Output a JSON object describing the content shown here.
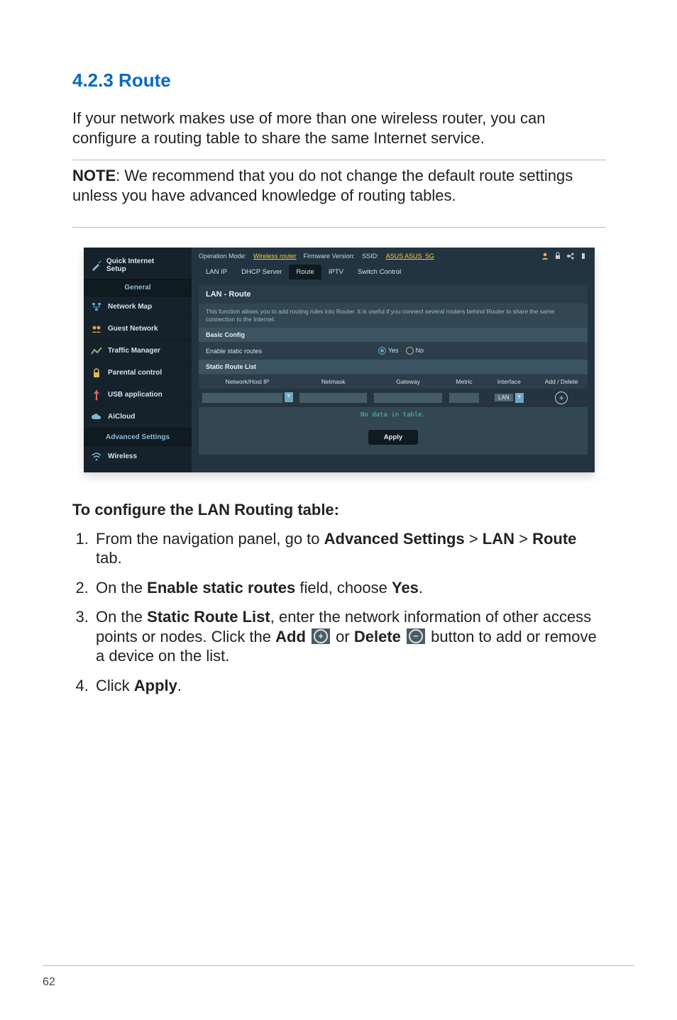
{
  "section_heading": "4.2.3 Route",
  "intro": "If your network makes use of more than one wireless router, you can configure a routing table to share the same Internet service.",
  "note_label": "NOTE",
  "note_body": ":  We recommend that you do not change the default route settings unless you have advanced knowledge of routing tables.",
  "screenshot": {
    "top": {
      "op_mode_label": "Operation Mode:",
      "op_mode_value": "Wireless router",
      "fw_label": "Firmware Version:",
      "ssid_label": "SSID:",
      "ssid_value": "ASUS  ASUS_5G"
    },
    "qis": {
      "line1": "Quick Internet",
      "line2": "Setup"
    },
    "sidebar": {
      "general_label": "General",
      "items_general": [
        "Network Map",
        "Guest Network",
        "Traffic Manager",
        "Parental control",
        "USB application",
        "AiCloud"
      ],
      "advanced_label": "Advanced Settings",
      "items_advanced": [
        "Wireless"
      ]
    },
    "tabs": [
      "LAN IP",
      "DHCP Server",
      "Route",
      "IPTV",
      "Switch Control"
    ],
    "active_tab_index": 2,
    "panel": {
      "title": "LAN - Route",
      "desc": "This function allows you to add routing rules into Router. It is useful if you connect several routers behind Router to share the same connection to the Internet.",
      "basic_config_label": "Basic Config",
      "row_label": "Enable static routes",
      "yes": "Yes",
      "no": "No",
      "static_list_label": "Static Route List",
      "columns": [
        "Network/Host IP",
        "Netmask",
        "Gateway",
        "Metric",
        "Interface",
        "Add / Delete"
      ],
      "iface_value": "LAN",
      "no_data": "No data in table.",
      "apply": "Apply"
    }
  },
  "subhead": "To configure the LAN Routing table:",
  "steps": {
    "s1a": "From the navigation panel, go to ",
    "s1b": "Advanced Settings",
    "s1c": " > ",
    "s1d": "LAN",
    "s1e": " > ",
    "s1f": "Route",
    "s1g": " tab.",
    "s2a": "On the ",
    "s2b": "Enable static routes",
    "s2c": " field, choose ",
    "s2d": "Yes",
    "s2e": ".",
    "s3a": "On the ",
    "s3b": "Static Route List",
    "s3c": ", enter the network information of other access points or nodes. Click the ",
    "s3d": "Add",
    "s3e": " or ",
    "s3f": "Delete",
    "s3g": " button to add or remove a device on the list.",
    "s4a": "Click ",
    "s4b": "Apply",
    "s4c": "."
  },
  "page_number": "62"
}
